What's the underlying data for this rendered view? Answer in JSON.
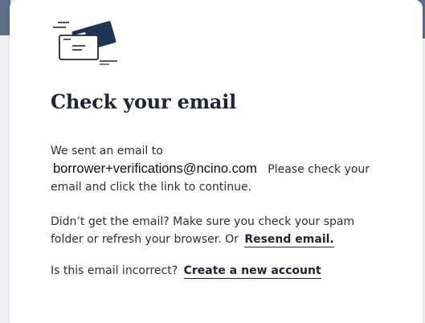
{
  "title": "Check your email",
  "sent": {
    "lead": "We sent an email to",
    "email": "borrower+verifications@ncino.com",
    "tail": "Please check your email and click the link to continue."
  },
  "not_received": {
    "text": "Didn’t get the email? Make sure you check your spam folder or refresh your browser. Or",
    "resend_link": "Resend email."
  },
  "incorrect": {
    "text": "Is this email incorrect?",
    "create_link": "Create a new account"
  },
  "colors": {
    "envelope_navy": "#1f3553",
    "text": "#1f2430"
  },
  "icons": {
    "header": "envelope-send-icon"
  }
}
